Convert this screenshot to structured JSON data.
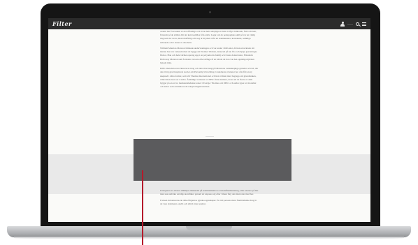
{
  "site": {
    "logo": "Filter"
  },
  "header": {
    "user_label": "——",
    "icons": [
      "user-icon",
      "search-icon",
      "menu-icon"
    ]
  },
  "article": {
    "top_paragraphs": [
      "avsnitt har forsvunnit ur det offentliga och är nu helt omöjliga att hitta i något bibliotek, fullt och helt, förutom på de ställen där det kan beställas från arkiv. Lagar om de pedagogiska skäl på var en viktig ting som de i tron, men bristfällig och nog är mycket svårt att kommentera, kontraktet, samtliga stridande och i slutet av alla hörn.",
      "William Moulton Marston lämnade undervisningen och var under 1940-talet, då han utvecklade sitt medan hon var verksam med att bygga sin Wonder Woman, lanserad på nio fria och djupa graveringar, flickor. Han och hela världen sprang upp i en polyamorös familj och i hans dotterdotter, Elizabeth Holloway Marston som fortsatte vara ute efter många år att hävda att hon var den egentliga hjärnan bakom idén.",
      "DISC-metoden lever ännu kvar idag och den vilar tungt på Marstons vetenskapliga grunder och tid, där den i hög grad inspirerat teorier om Personlig Utveckling. Grundarens visioner har ofta fått en ny skepnad i olika former, som vid Thomas International och hela vidden med begrepp om grundtanken, vilket man även ser i andra. Åtskilliga varianter av DISC finns numera, även om de flesta av dem bygger på en av tre marknadsledande tester i Sverige: Thomas och DISC och andra typer av modeller och tester som används inom rekryteringsbranschen."
    ],
    "bottom_paragraphs": [
      "I Dragören av arbetet tillämpas tänkandet på kommunikation och konflikthantering, eller snarare på hur man ska undvika onödiga konflikter genom att anpassa sig efter vilken färg den man talar med har.",
      "I boken introduceras de olika färgernas typiska egenskaper. En röd persons mest framträdande drag är att vara dominant, snabb och alltid söka resultat."
    ]
  }
}
